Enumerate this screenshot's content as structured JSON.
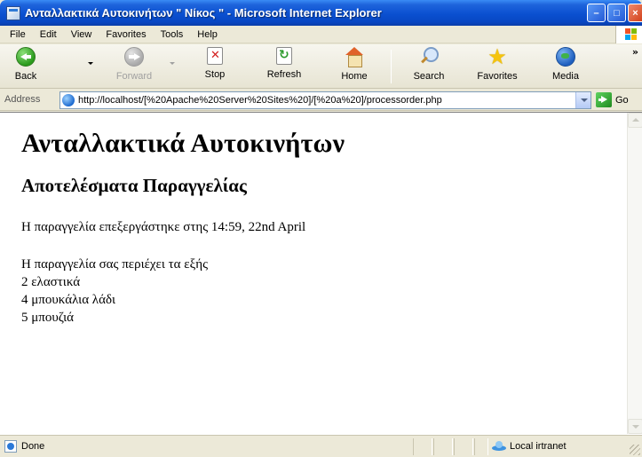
{
  "window": {
    "title": "Ανταλλακτικά Αυτοκινήτων \" Νίκος \" - Microsoft Internet Explorer",
    "minimize": "–",
    "maximize": "□",
    "close": "×"
  },
  "menu": {
    "items": [
      "File",
      "Edit",
      "View",
      "Favorites",
      "Tools",
      "Help"
    ]
  },
  "toolbar": {
    "back": "Back",
    "forward": "Forward",
    "stop": "Stop",
    "refresh": "Refresh",
    "home": "Home",
    "search": "Search",
    "favorites": "Favorites",
    "media": "Media",
    "more": "»"
  },
  "address": {
    "label": "Address",
    "url": "http://localhost/[%20Apache%20Server%20Sites%20]/[%20a%20]/processorder.php",
    "go": "Go"
  },
  "page": {
    "heading": "Ανταλλακτικά Αυτοκινήτων",
    "subheading": "Αποτελέσματα Παραγγελίας",
    "processed": "Η παραγγελία επεξεργάστηκε στης 14:59, 22nd April",
    "summary_intro": "Η παραγγελία σας περιέχει τα εξής",
    "items": [
      "2 ελαστικά",
      "4 μπουκάλια λάδι",
      "5 μπουζιά"
    ]
  },
  "status": {
    "text": "Done",
    "zone": "Local irtranet"
  },
  "colors": {
    "titlebar": "#0a50d0",
    "chrome": "#ece9d8",
    "content_bg": "#ffffff"
  }
}
